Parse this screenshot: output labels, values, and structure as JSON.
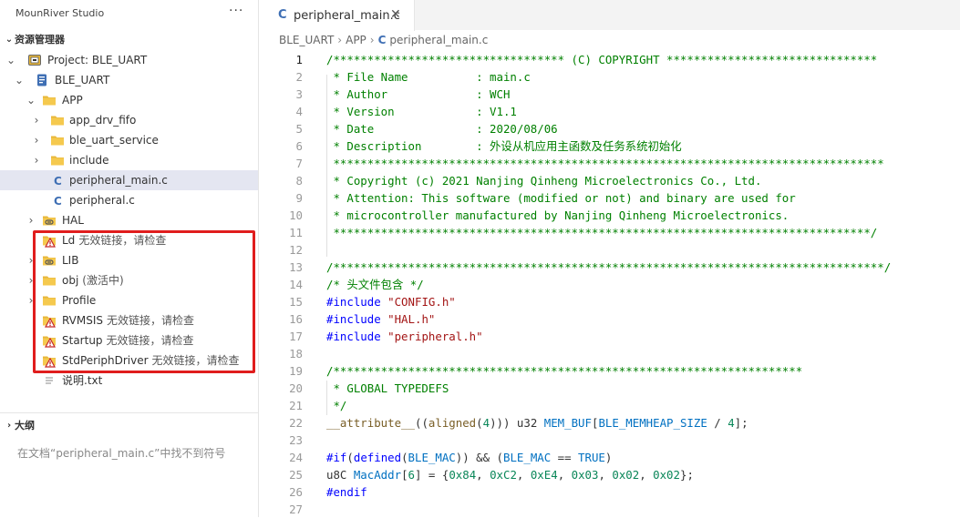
{
  "sidebar": {
    "header": "MounRiver Studio",
    "more": "···",
    "explorer_title": "资源管理器",
    "tree": [
      {
        "label": "Project: BLE_UART",
        "icon": "project-icon",
        "chev": "⌄",
        "indent": 1
      },
      {
        "label": "BLE_UART",
        "icon": "book-icon",
        "chev": "⌄",
        "indent": 2
      },
      {
        "label": "APP",
        "icon": "folder-icon",
        "chev": "⌄",
        "indent": 3
      },
      {
        "label": "app_drv_fifo",
        "icon": "folder-icon",
        "chev": "›",
        "indent": 4
      },
      {
        "label": "ble_uart_service",
        "icon": "folder-icon",
        "chev": "›",
        "indent": 4
      },
      {
        "label": "include",
        "icon": "folder-icon",
        "chev": "›",
        "indent": 4
      },
      {
        "label": "peripheral_main.c",
        "icon": "c-file-icon",
        "chev": "",
        "indent": 4,
        "selected": true
      },
      {
        "label": "peripheral.c",
        "icon": "c-file-icon",
        "chev": "",
        "indent": 4
      },
      {
        "label": "HAL",
        "icon": "folder-link-icon",
        "chev": "›",
        "indent": 3
      },
      {
        "label": "Ld",
        "suffix": "无效链接，请检查",
        "icon": "folder-warning-icon",
        "chev": "",
        "indent": 3
      },
      {
        "label": "LIB",
        "icon": "folder-link-icon",
        "chev": "›",
        "indent": 3
      },
      {
        "label": "obj",
        "suffix": "(激活中)",
        "icon": "folder-icon",
        "chev": "›",
        "indent": 3
      },
      {
        "label": "Profile",
        "icon": "folder-icon",
        "chev": "›",
        "indent": 3
      },
      {
        "label": "RVMSIS",
        "suffix": "无效链接，请检查",
        "icon": "folder-warning-icon",
        "chev": "",
        "indent": 3
      },
      {
        "label": "Startup",
        "suffix": "无效链接，请检查",
        "icon": "folder-warning-icon",
        "chev": "",
        "indent": 3
      },
      {
        "label": "StdPeriphDriver",
        "suffix": "无效链接，请检查",
        "icon": "folder-warning-icon",
        "chev": "",
        "indent": 3
      },
      {
        "label": "说明.txt",
        "icon": "text-file-icon",
        "chev": "",
        "indent": 3
      }
    ],
    "outline_title": "大纲",
    "outline_empty": "在文档“peripheral_main.c”中找不到符号"
  },
  "editor": {
    "tab_label": "peripheral_main.c",
    "tab_icon": "C",
    "tab_close": "✕",
    "breadcrumb": [
      "BLE_UART",
      "APP",
      "peripheral_main.c"
    ],
    "active_line": 1,
    "lines": [
      [
        [
          "cmt",
          "/********************************** (C) COPYRIGHT *******************************"
        ]
      ],
      [
        [
          "cmt",
          " * File Name          : main.c"
        ]
      ],
      [
        [
          "cmt",
          " * Author             : WCH"
        ]
      ],
      [
        [
          "cmt",
          " * Version            : V1.1"
        ]
      ],
      [
        [
          "cmt",
          " * Date               : 2020/08/06"
        ]
      ],
      [
        [
          "cmt",
          " * Description        : 外设从机应用主函数及任务系统初始化"
        ]
      ],
      [
        [
          "cmt",
          " *********************************************************************************"
        ]
      ],
      [
        [
          "cmt",
          " * Copyright (c) 2021 Nanjing Qinheng Microelectronics Co., Ltd."
        ]
      ],
      [
        [
          "cmt",
          " * Attention: This software (modified or not) and binary are used for"
        ]
      ],
      [
        [
          "cmt",
          " * microcontroller manufactured by Nanjing Qinheng Microelectronics."
        ]
      ],
      [
        [
          "cmt",
          " *******************************************************************************/"
        ]
      ],
      [],
      [
        [
          "cmt",
          "/*********************************************************************************/"
        ]
      ],
      [
        [
          "cmt",
          "/* 头文件包含 */"
        ]
      ],
      [
        [
          "pre",
          "#include "
        ],
        [
          "str",
          "\"CONFIG.h\""
        ]
      ],
      [
        [
          "pre",
          "#include "
        ],
        [
          "str",
          "\"HAL.h\""
        ]
      ],
      [
        [
          "pre",
          "#include "
        ],
        [
          "str",
          "\"peripheral.h\""
        ]
      ],
      [],
      [
        [
          "cmt",
          "/*********************************************************************"
        ]
      ],
      [
        [
          "cmt",
          " * GLOBAL TYPEDEFS"
        ]
      ],
      [
        [
          "cmt",
          " */"
        ]
      ],
      [
        [
          "fn",
          "__attribute__"
        ],
        [
          "plain",
          "(("
        ],
        [
          "fn",
          "aligned"
        ],
        [
          "plain",
          "("
        ],
        [
          "num",
          "4"
        ],
        [
          "plain",
          "))) u32 "
        ],
        [
          "mac",
          "MEM_BUF"
        ],
        [
          "plain",
          "["
        ],
        [
          "mac",
          "BLE_MEMHEAP_SIZE"
        ],
        [
          "plain",
          " / "
        ],
        [
          "num",
          "4"
        ],
        [
          "plain",
          "];"
        ]
      ],
      [],
      [
        [
          "pre",
          "#if"
        ],
        [
          "plain",
          "("
        ],
        [
          "pre",
          "defined"
        ],
        [
          "plain",
          "("
        ],
        [
          "mac",
          "BLE_MAC"
        ],
        [
          "plain",
          ")) && ("
        ],
        [
          "mac",
          "BLE_MAC"
        ],
        [
          "plain",
          " == "
        ],
        [
          "mac",
          "TRUE"
        ],
        [
          "plain",
          ")"
        ]
      ],
      [
        [
          "plain",
          "u8C "
        ],
        [
          "mac",
          "MacAddr"
        ],
        [
          "plain",
          "["
        ],
        [
          "num",
          "6"
        ],
        [
          "plain",
          "] = {"
        ],
        [
          "num",
          "0x84"
        ],
        [
          "plain",
          ", "
        ],
        [
          "num",
          "0xC2"
        ],
        [
          "plain",
          ", "
        ],
        [
          "num",
          "0xE4"
        ],
        [
          "plain",
          ", "
        ],
        [
          "num",
          "0x03"
        ],
        [
          "plain",
          ", "
        ],
        [
          "num",
          "0x02"
        ],
        [
          "plain",
          ", "
        ],
        [
          "num",
          "0x02"
        ],
        [
          "plain",
          "};"
        ]
      ],
      [
        [
          "pre",
          "#endif"
        ]
      ],
      []
    ]
  },
  "colors": {
    "accent": "#3f6fb4",
    "warning_box": "#e01d1d",
    "folder": "#e8b73a",
    "selected_row": "#e4e6f1",
    "comment": "#008000"
  }
}
